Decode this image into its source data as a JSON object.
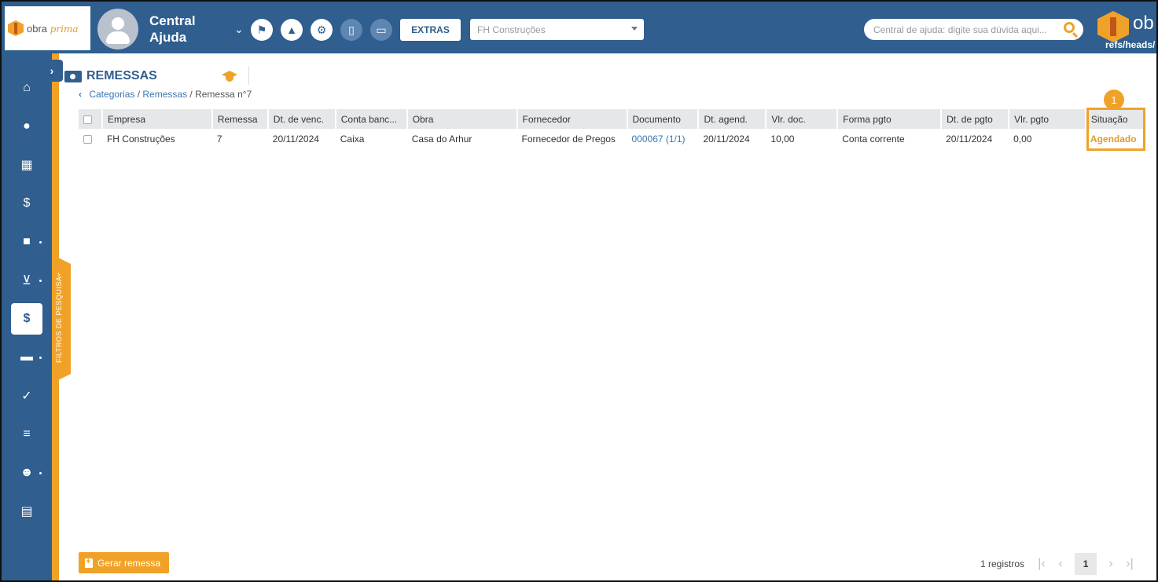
{
  "header": {
    "logo_text": "obra",
    "logo_accent": "prima",
    "user_name": "Central Ajuda",
    "extras_label": "EXTRAS",
    "company_select_value": "FH Construções",
    "search_placeholder": "Central de ajuda: digite sua dúvida aqui...",
    "brand_text": "ob",
    "refs_text": "refs/heads/",
    "icons": [
      "flag-icon",
      "graduation-cap-icon",
      "gear-icon",
      "mobile-icon",
      "desktop-icon"
    ]
  },
  "sidebar": {
    "items": [
      {
        "icon": "home-icon",
        "glyph": "⌂"
      },
      {
        "icon": "user-icon",
        "glyph": "●"
      },
      {
        "icon": "building-icon",
        "glyph": "▦"
      },
      {
        "icon": "invoice-icon",
        "glyph": "$"
      },
      {
        "icon": "truck-icon",
        "glyph": "■"
      },
      {
        "icon": "cart-icon",
        "glyph": "⊻"
      },
      {
        "icon": "dollar-icon",
        "glyph": "$"
      },
      {
        "icon": "archive-icon",
        "glyph": "▬"
      },
      {
        "icon": "file-check-icon",
        "glyph": "✓"
      },
      {
        "icon": "checklist-icon",
        "glyph": "≡"
      },
      {
        "icon": "users-icon",
        "glyph": "☻"
      },
      {
        "icon": "document-icon",
        "glyph": "▤"
      }
    ],
    "filter_label": "FILTROS DE PESQUISA"
  },
  "page": {
    "title": "REMESSAS",
    "breadcrumb": {
      "cat": "Categorias",
      "rem": "Remessas",
      "current": "Remessa n°7"
    }
  },
  "table": {
    "headers": [
      "Empresa",
      "Remessa",
      "Dt. de venc.",
      "Conta banc...",
      "Obra",
      "Fornecedor",
      "Documento",
      "Dt. agend.",
      "Vlr. doc.",
      "Forma pgto",
      "Dt. de pgto",
      "Vlr. pgto",
      "Situação"
    ],
    "rows": [
      [
        "FH Construções",
        "7",
        "20/11/2024",
        "Caixa",
        "Casa do Arhur",
        "Fornecedor de Pregos",
        "000067 (1/1)",
        "20/11/2024",
        "10,00",
        "Conta corrente",
        "20/11/2024",
        "0,00",
        "Agendado"
      ]
    ]
  },
  "marker_number": "1",
  "footer": {
    "gerar_label": "Gerar remessa",
    "record_count": "1 registros",
    "current_page": "1"
  },
  "colors": {
    "primary": "#2f5e8f",
    "accent": "#f0a228",
    "link": "#3a77b0"
  }
}
